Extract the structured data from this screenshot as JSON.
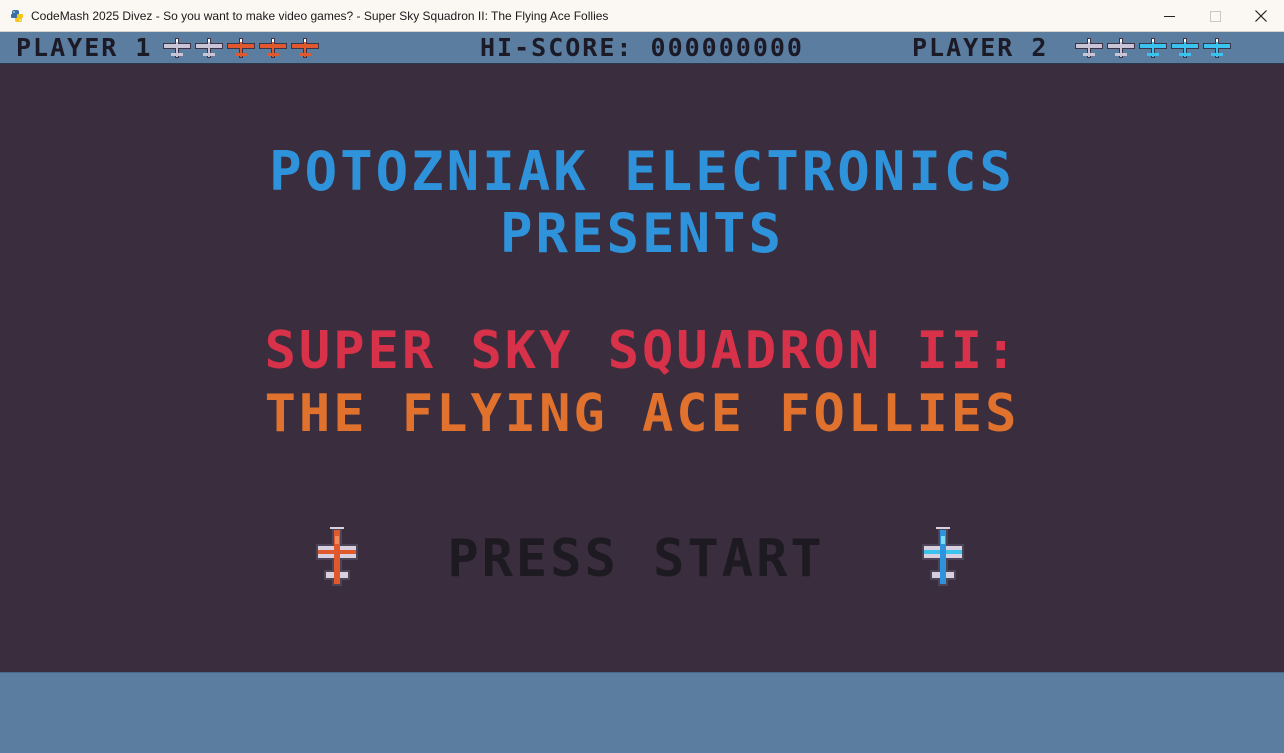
{
  "window": {
    "title": "CodeMash 2025 Divez - So you want to make video games? - Super Sky Squadron II: The Flying Ace Follies",
    "icon": "python-icon",
    "controls": [
      "minimize-icon",
      "maximize-icon",
      "close-icon"
    ]
  },
  "hud": {
    "player1_label": "PLAYER 1",
    "player1_lives_total": 5,
    "player1_lives_colors": [
      "#c9c5d6",
      "#c9c5d6",
      "#e0582e",
      "#e0582e",
      "#e0582e"
    ],
    "hiscore": "HI-SCORE: 000000000",
    "player2_label": "PLAYER 2",
    "player2_lives_total": 5,
    "player2_lives_colors": [
      "#c9c5d6",
      "#c9c5d6",
      "#39c3ee",
      "#39c3ee",
      "#39c3ee"
    ]
  },
  "screen": {
    "presenter_line1": "POTOZNIAK ELECTRONICS",
    "presenter_line2": "PRESENTS",
    "title_line1": "SUPER SKY SQUADRON II:",
    "title_line2": "THE FLYING ACE FOLLIES",
    "press_start": "PRESS START",
    "player1_ship": "orange-plane-icon",
    "player2_ship": "blue-plane-icon"
  },
  "colors": {
    "background": "#3a2d3e",
    "hud_bar": "#5b7da0",
    "presenter": "#2f93db",
    "title_red": "#d8314a",
    "title_orange": "#e0722e",
    "press_start": "#1d1a22"
  }
}
